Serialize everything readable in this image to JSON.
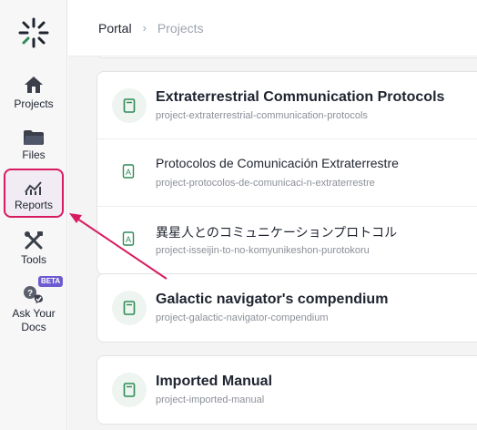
{
  "sidebar": {
    "items": [
      {
        "label": "Projects",
        "icon": "home-icon"
      },
      {
        "label": "Files",
        "icon": "folder-icon"
      },
      {
        "label": "Reports",
        "icon": "chart-icon"
      },
      {
        "label": "Tools",
        "icon": "tools-icon"
      },
      {
        "label": "Ask Your Docs",
        "icon": "ask-docs-icon"
      }
    ],
    "beta_badge": "BETA"
  },
  "breadcrumb": {
    "portal": "Portal",
    "separator": "›",
    "current": "Projects"
  },
  "groups": [
    {
      "rows": [
        {
          "title": "Extraterrestrial Communication Protocols",
          "slug": "project-extraterrestrial-communication-protocols"
        },
        {
          "title": "Protocolos de Comunicación Extraterrestre",
          "slug": "project-protocolos-de-comunicaci-n-extraterrestre"
        },
        {
          "title": "異星人とのコミュニケーションプロトコル",
          "slug": "project-isseijin-to-no-komyunikeshon-purotokoru"
        }
      ]
    },
    {
      "rows": [
        {
          "title": "Galactic navigator's compendium",
          "slug": "project-galactic-navigator-compendium"
        }
      ]
    },
    {
      "rows": [
        {
          "title": "Imported Manual",
          "slug": "project-imported-manual"
        }
      ]
    }
  ],
  "colors": {
    "accent": "#d81b60",
    "icon_green": "#2e8b57",
    "beta": "#6d5bd0"
  }
}
